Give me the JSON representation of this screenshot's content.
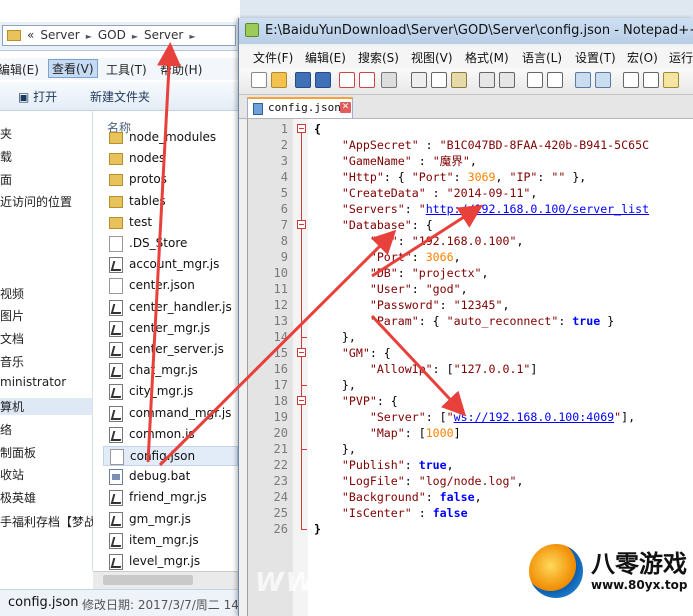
{
  "explorer": {
    "breadcrumbs": [
      "«",
      "Server",
      "►",
      "GOD",
      "►",
      "Server",
      "►"
    ],
    "menu": [
      "编辑(E)",
      "查看(V)",
      "工具(T)",
      "帮助(H)"
    ],
    "commands": [
      "打开",
      "新建文件夹"
    ],
    "nav_items": [
      "夹",
      "载",
      "面",
      "近访问的位置",
      "视频",
      "图片",
      "文档",
      "音乐",
      "ministrator",
      "算机",
      "络",
      "制面板",
      "收站",
      "极英雄",
      "手福利存档【梦战"
    ],
    "column_header": "名称",
    "files": [
      {
        "name": "node_modules",
        "type": "dir"
      },
      {
        "name": "nodes",
        "type": "dir"
      },
      {
        "name": "protos",
        "type": "dir"
      },
      {
        "name": "tables",
        "type": "dir"
      },
      {
        "name": "test",
        "type": "dir"
      },
      {
        "name": ".DS_Store",
        "type": "doc"
      },
      {
        "name": "account_mgr.js",
        "type": "js"
      },
      {
        "name": "center.json",
        "type": "doc"
      },
      {
        "name": "center_handler.js",
        "type": "js"
      },
      {
        "name": "center_mgr.js",
        "type": "js"
      },
      {
        "name": "center_server.js",
        "type": "js"
      },
      {
        "name": "chat_mgr.js",
        "type": "js"
      },
      {
        "name": "city_mgr.js",
        "type": "js"
      },
      {
        "name": "command_mgr.js",
        "type": "js"
      },
      {
        "name": "common.js",
        "type": "js"
      },
      {
        "name": "config.json",
        "type": "doc"
      },
      {
        "name": "debug.bat",
        "type": "bat"
      },
      {
        "name": "friend_mgr.js",
        "type": "js"
      },
      {
        "name": "gm_mgr.js",
        "type": "js"
      },
      {
        "name": "item_mgr.js",
        "type": "js"
      },
      {
        "name": "level_mgr.js",
        "type": "js"
      }
    ],
    "status": {
      "filename": "config.json",
      "modified": "修改日期: 2017/3/7/周二 14"
    }
  },
  "npp": {
    "title": "E:\\BaiduYunDownload\\Server\\GOD\\Server\\config.json - Notepad++ [Adm",
    "menu": [
      "文件(F)",
      "编辑(E)",
      "搜索(S)",
      "视图(V)",
      "格式(M)",
      "语言(L)",
      "设置(T)",
      "宏(O)",
      "运行"
    ],
    "tab": "config.json",
    "line_numbers": [
      "1",
      "2",
      "3",
      "4",
      "5",
      "6",
      "7",
      "8",
      "9",
      "10",
      "11",
      "12",
      "13",
      "14",
      "15",
      "16",
      "17",
      "18",
      "19",
      "20",
      "21",
      "22",
      "23",
      "24",
      "25",
      "26"
    ],
    "code": [
      [
        [
          "p",
          "{"
        ]
      ],
      [
        [
          "t",
          "    "
        ],
        [
          "k",
          "\"AppSecret\""
        ],
        [
          "t",
          " : "
        ],
        [
          "s",
          "\"B1C047BD-8FAA-420b-B941-5C65C"
        ]
      ],
      [
        [
          "t",
          "    "
        ],
        [
          "k",
          "\"GameName\""
        ],
        [
          "t",
          " : "
        ],
        [
          "s",
          "\"魔界\""
        ],
        [
          "t",
          ","
        ]
      ],
      [
        [
          "t",
          "    "
        ],
        [
          "k",
          "\"Http\""
        ],
        [
          "t",
          ": { "
        ],
        [
          "k",
          "\"Port\""
        ],
        [
          "t",
          ": "
        ],
        [
          "n",
          "3069"
        ],
        [
          "t",
          ", "
        ],
        [
          "k",
          "\"IP\""
        ],
        [
          "t",
          ": "
        ],
        [
          "s",
          "\"\""
        ],
        [
          "t",
          " },"
        ]
      ],
      [
        [
          "t",
          "    "
        ],
        [
          "k",
          "\"CreateData\""
        ],
        [
          "t",
          " : "
        ],
        [
          "s",
          "\"2014-09-11\""
        ],
        [
          "t",
          ","
        ]
      ],
      [
        [
          "t",
          "    "
        ],
        [
          "k",
          "\"Servers\""
        ],
        [
          "t",
          ": "
        ],
        [
          "s",
          "\""
        ],
        [
          "u",
          "http://192.168.0.100/server_list"
        ]
      ],
      [
        [
          "t",
          "    "
        ],
        [
          "k",
          "\"Database\""
        ],
        [
          "t",
          ": {"
        ]
      ],
      [
        [
          "t",
          "        "
        ],
        [
          "k",
          "\"IP\""
        ],
        [
          "t",
          ": "
        ],
        [
          "s",
          "\"192.168.0.100\""
        ],
        [
          "t",
          ","
        ]
      ],
      [
        [
          "t",
          "        "
        ],
        [
          "k",
          "\"Port\""
        ],
        [
          "t",
          ": "
        ],
        [
          "n",
          "3066"
        ],
        [
          "t",
          ","
        ]
      ],
      [
        [
          "t",
          "        "
        ],
        [
          "k",
          "\"DB\""
        ],
        [
          "t",
          ": "
        ],
        [
          "s",
          "\"projectx\""
        ],
        [
          "t",
          ","
        ]
      ],
      [
        [
          "t",
          "        "
        ],
        [
          "k",
          "\"User\""
        ],
        [
          "t",
          ": "
        ],
        [
          "s",
          "\"god\""
        ],
        [
          "t",
          ","
        ]
      ],
      [
        [
          "t",
          "        "
        ],
        [
          "k",
          "\"Password\""
        ],
        [
          "t",
          ": "
        ],
        [
          "s",
          "\"12345\""
        ],
        [
          "t",
          ","
        ]
      ],
      [
        [
          "t",
          "        "
        ],
        [
          "k",
          "\"Param\""
        ],
        [
          "t",
          ": { "
        ],
        [
          "k",
          "\"auto_reconnect\""
        ],
        [
          "t",
          ": "
        ],
        [
          "b",
          "true"
        ],
        [
          "t",
          " }"
        ]
      ],
      [
        [
          "t",
          "    },"
        ]
      ],
      [
        [
          "t",
          "    "
        ],
        [
          "k",
          "\"GM\""
        ],
        [
          "t",
          ": {"
        ]
      ],
      [
        [
          "t",
          "        "
        ],
        [
          "k",
          "\"AllowIp\""
        ],
        [
          "t",
          ": ["
        ],
        [
          "s",
          "\"127.0.0.1\""
        ],
        [
          "t",
          "]"
        ]
      ],
      [
        [
          "t",
          "    },"
        ]
      ],
      [
        [
          "t",
          "    "
        ],
        [
          "k",
          "\"PVP\""
        ],
        [
          "t",
          ": {"
        ]
      ],
      [
        [
          "t",
          "        "
        ],
        [
          "k",
          "\"Server\""
        ],
        [
          "t",
          ": ["
        ],
        [
          "s",
          "\""
        ],
        [
          "u",
          "ws://192.168.0.100:4069"
        ],
        [
          "s",
          "\""
        ],
        [
          "t",
          "],"
        ]
      ],
      [
        [
          "t",
          "        "
        ],
        [
          "k",
          "\"Map\""
        ],
        [
          "t",
          ": ["
        ],
        [
          "n",
          "1000"
        ],
        [
          "t",
          "]"
        ]
      ],
      [
        [
          "t",
          "    },"
        ]
      ],
      [
        [
          "t",
          "    "
        ],
        [
          "k",
          "\"Publish\""
        ],
        [
          "t",
          ": "
        ],
        [
          "b",
          "true"
        ],
        [
          "t",
          ","
        ]
      ],
      [
        [
          "t",
          "    "
        ],
        [
          "k",
          "\"LogFile\""
        ],
        [
          "t",
          ": "
        ],
        [
          "s",
          "\"log/node.log\""
        ],
        [
          "t",
          ","
        ]
      ],
      [
        [
          "t",
          "    "
        ],
        [
          "k",
          "\"Background\""
        ],
        [
          "t",
          ": "
        ],
        [
          "b",
          "false"
        ],
        [
          "t",
          ","
        ]
      ],
      [
        [
          "t",
          "    "
        ],
        [
          "k",
          "\"IsCenter\""
        ],
        [
          "t",
          " : "
        ],
        [
          "b",
          "false"
        ]
      ],
      [
        [
          "p",
          "}"
        ]
      ]
    ]
  },
  "watermark": {
    "brand": "八零游戏",
    "url": "www.80yx.top"
  },
  "colors": {
    "key": "#800000",
    "number": "#ff8000",
    "keyword": "#0000ff",
    "arrow": "#e8403a"
  }
}
